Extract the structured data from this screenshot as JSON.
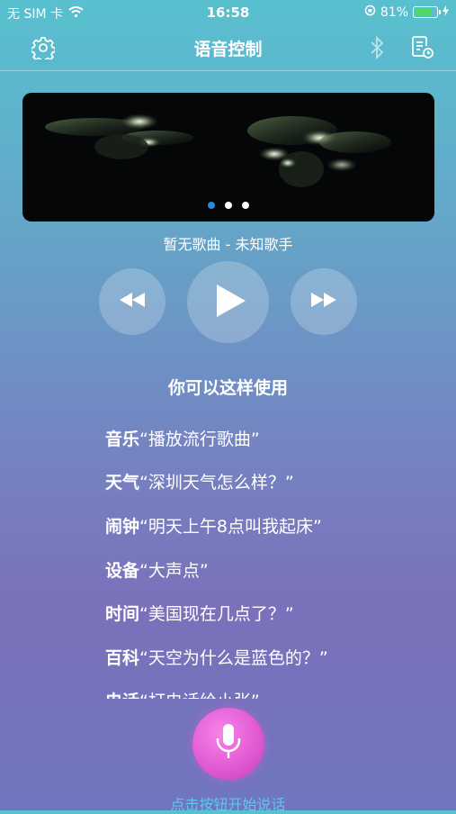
{
  "status_bar": {
    "carrier": "无 SIM 卡",
    "time": "16:58",
    "battery": "81%",
    "battery_level": 0.81
  },
  "nav": {
    "title": "语音控制",
    "left_icon": "gear-icon",
    "right_icons": [
      "bluetooth-icon",
      "playlist-history-icon"
    ]
  },
  "banner": {
    "page_count": 3,
    "active_page": 0
  },
  "player": {
    "song_info": "暂无歌曲 - 未知歌手",
    "controls": [
      "rewind-icon",
      "play-icon",
      "fast-forward-icon"
    ]
  },
  "tips": {
    "title": "你可以这样使用",
    "items": [
      {
        "category": "音乐",
        "example": "“播放流行歌曲”"
      },
      {
        "category": "天气",
        "example": "“深圳天气怎么样？”"
      },
      {
        "category": "闹钟",
        "example": "“明天上午8点叫我起床”"
      },
      {
        "category": "设备",
        "example": "“大声点”"
      },
      {
        "category": "时间",
        "example": "“美国现在几点了？”"
      },
      {
        "category": "百科",
        "example": "“天空为什么是蓝色的？”"
      },
      {
        "category": "电话",
        "example": "“打电话给小张”"
      }
    ]
  },
  "mic": {
    "hint": "点击按钮开始说话",
    "color": "#e35bd4"
  },
  "colors": {
    "background_top": "#58c0cf",
    "background_bottom": "#7a71ba",
    "hint_text": "#5ec6f0"
  }
}
